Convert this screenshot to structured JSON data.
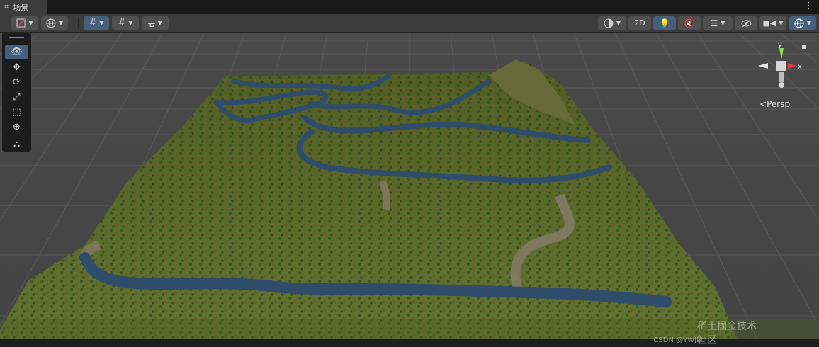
{
  "tab": {
    "icon": "grid-icon",
    "title": "场景"
  },
  "toolbar": {
    "view_2d_label": "2D"
  },
  "gizmo": {
    "axis_y": "y",
    "axis_x": "x",
    "projection_label": "Persp"
  },
  "watermark": "稀土掘金技术社区",
  "watermark_small": "CSDN @YWJLL",
  "colors": {
    "grass": "#5a6b2a",
    "river": "#2f4d6b",
    "dirt": "#7d7662",
    "grid_bg": "#474747",
    "accent": "#46607c"
  }
}
